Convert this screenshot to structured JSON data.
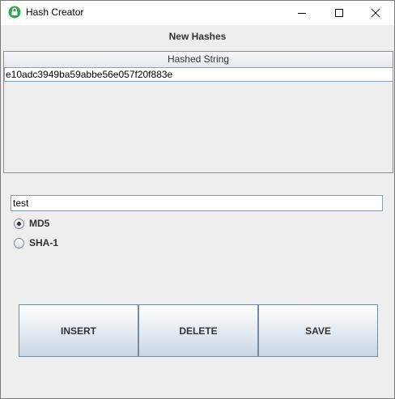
{
  "window": {
    "title": "Hash Creator"
  },
  "header": {
    "title": "New Hashes"
  },
  "table": {
    "columns": [
      "Hashed String"
    ],
    "rows": [
      [
        "e10adc3949ba59abbe56e057f20f883e"
      ]
    ]
  },
  "input": {
    "value": "test"
  },
  "algorithms": {
    "options": [
      "MD5",
      "SHA-1"
    ],
    "selected": "MD5"
  },
  "buttons": {
    "insert": "INSERT",
    "delete": "DELETE",
    "save": "SAVE"
  },
  "colors": {
    "accent": "#2fa84f",
    "window_bg": "#eeeeee",
    "row_border": "#8a9fb8"
  }
}
